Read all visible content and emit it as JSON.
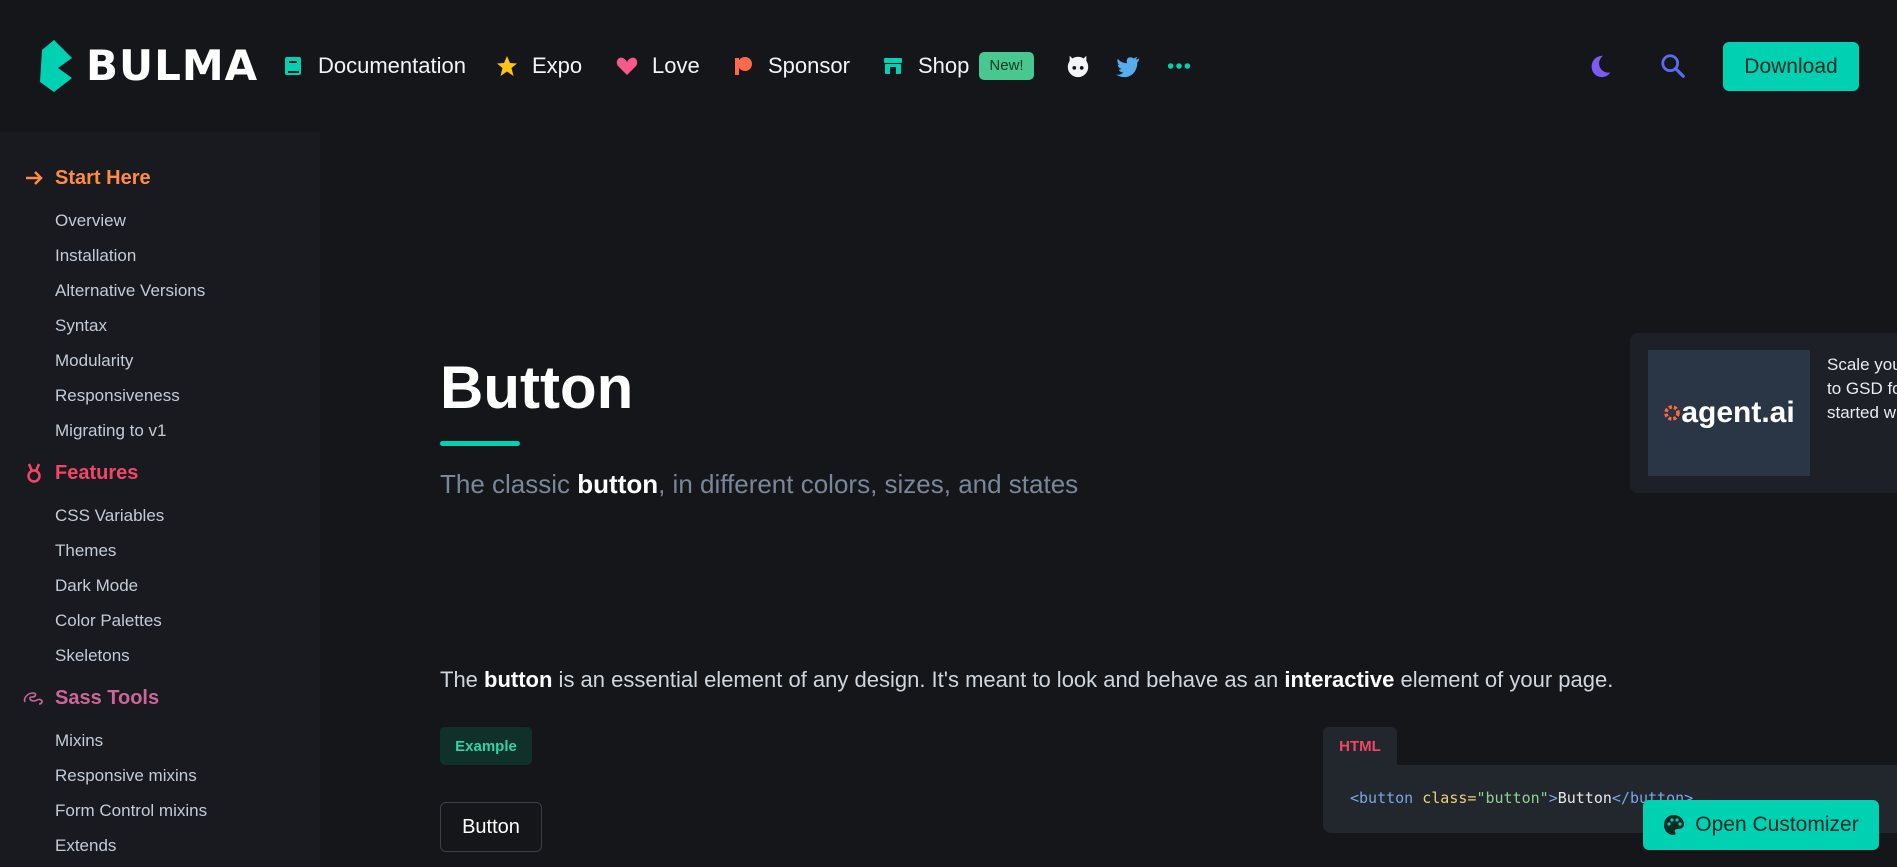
{
  "brand": {
    "name": "BULMA"
  },
  "nav": {
    "documentation": "Documentation",
    "expo": "Expo",
    "love": "Love",
    "sponsor": "Sponsor",
    "shop": "Shop",
    "new_badge": "New!",
    "download": "Download"
  },
  "sidebar": {
    "start_here": {
      "title": "Start Here",
      "items": [
        "Overview",
        "Installation",
        "Alternative Versions",
        "Syntax",
        "Modularity",
        "Responsiveness",
        "Migrating to v1"
      ]
    },
    "features": {
      "title": "Features",
      "items": [
        "CSS Variables",
        "Themes",
        "Dark Mode",
        "Color Palettes",
        "Skeletons"
      ]
    },
    "sass_tools": {
      "title": "Sass Tools",
      "items": [
        "Mixins",
        "Responsive mixins",
        "Form Control mixins",
        "Extends"
      ]
    }
  },
  "main": {
    "title": "Button",
    "subtitle_pre": "The classic ",
    "subtitle_bold": "button",
    "subtitle_post": ", in different colors, sizes, and states",
    "intro_1": "The ",
    "intro_2": "button",
    "intro_3": " is an essential element of any design. It's meant to look and behave as an ",
    "intro_4": "interactive",
    "intro_5": " element of your page.",
    "example_tag": "Example",
    "demo_button": "Button"
  },
  "ad": {
    "logo": "agent.ai",
    "text": "Scale you\nto GSD fo\nstarted w"
  },
  "code": {
    "tab": "HTML",
    "open_tag": "<button",
    "attr": " class=",
    "value": "\"button\"",
    "close_bracket": ">",
    "content": "Button",
    "end_tag": "</button>"
  },
  "customizer": {
    "label": "Open Customizer"
  },
  "colors": {
    "accent": "#00d1b2",
    "start_here": "#ff8c42",
    "features": "#f14668",
    "sass_tools": "#cc6699"
  }
}
